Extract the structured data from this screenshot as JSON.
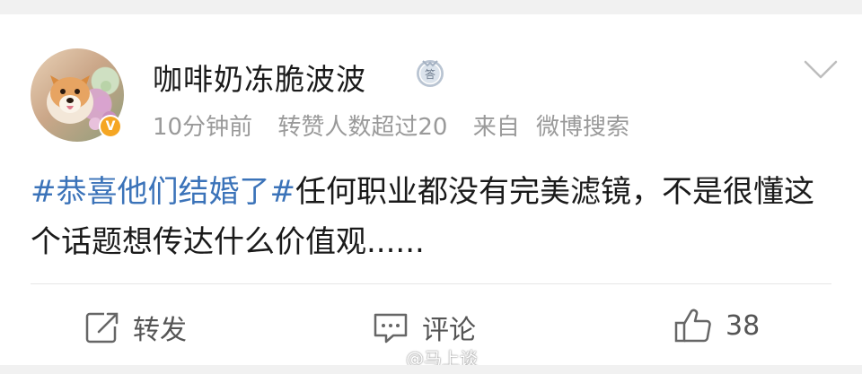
{
  "post": {
    "username": "咖啡奶冻脆波波",
    "medal_icon": "answer-medal-icon",
    "verified_icon": "verified-v-icon",
    "time": "10分钟前",
    "repost_info": "转赞人数超过20",
    "source_prefix": "来自",
    "source": "微博搜索",
    "topic1": "#恭喜他们结婚了#",
    "text": "任何职业都没有完美滤镜，不是很懂这个话题想传达什么价值观......"
  },
  "actions": {
    "repost_label": "转发",
    "comment_label": "评论",
    "like_count": "38"
  },
  "watermark": {
    "text": "@马上谈"
  },
  "colors": {
    "topic": "#3b73b9",
    "meta": "#9a9a9a",
    "verified": "#f5a623"
  }
}
